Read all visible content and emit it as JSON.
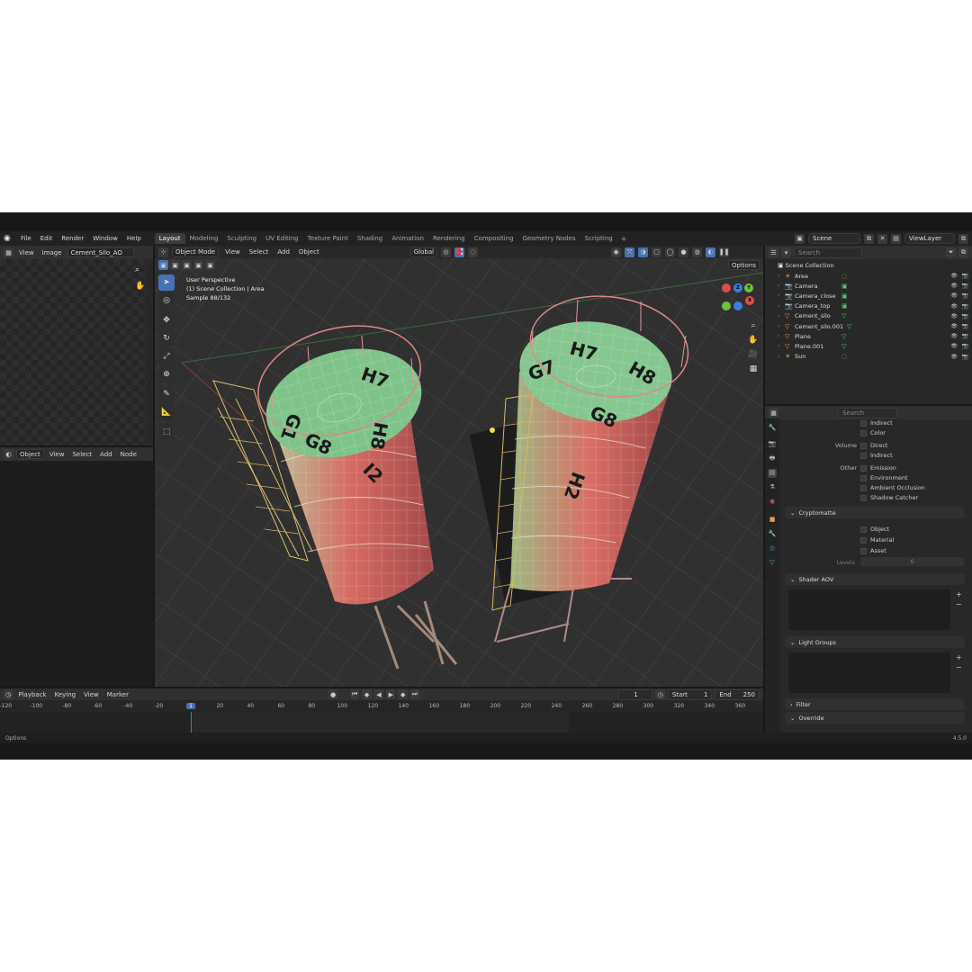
{
  "menu": [
    "File",
    "Edit",
    "Render",
    "Window",
    "Help"
  ],
  "workspaces": [
    "Layout",
    "Modeling",
    "Sculpting",
    "UV Editing",
    "Texture Paint",
    "Shading",
    "Animation",
    "Rendering",
    "Compositing",
    "Geometry Nodes",
    "Scripting"
  ],
  "active_workspace": "Layout",
  "scene_name": "Scene",
  "view_layer": "ViewLayer",
  "image_editor": {
    "menu": [
      "View",
      "Image"
    ],
    "image_name": "Cement_Silo_AO"
  },
  "node_editor": {
    "mode": "Object",
    "menu": [
      "View",
      "Select",
      "Add",
      "Node"
    ]
  },
  "viewport": {
    "mode": "Object Mode",
    "menu": [
      "View",
      "Select",
      "Add",
      "Object"
    ],
    "transform": "Global",
    "options": "Options",
    "info_line1": "User Perspective",
    "info_line2": "(1) Scene Collection | Area",
    "info_line3": "Sample 88/132",
    "silo_labels_left": [
      "H7",
      "G1",
      "H8",
      "G8",
      "I2"
    ],
    "silo_labels_right": [
      "H7",
      "G7",
      "H8",
      "G8",
      "H2"
    ]
  },
  "outliner": {
    "search_placeholder": "Search",
    "root": "Scene Collection",
    "items": [
      {
        "name": "Area",
        "icon": "light-icon"
      },
      {
        "name": "Camera",
        "icon": "camera-icon"
      },
      {
        "name": "Camera_close",
        "icon": "camera-icon"
      },
      {
        "name": "Camera_top",
        "icon": "camera-icon"
      },
      {
        "name": "Cement_silo",
        "icon": "mesh-icon"
      },
      {
        "name": "Cement_silo.001",
        "icon": "mesh-icon"
      },
      {
        "name": "Plane",
        "icon": "mesh-icon"
      },
      {
        "name": "Plane.001",
        "icon": "mesh-icon"
      },
      {
        "name": "Sun",
        "icon": "light-icon"
      }
    ]
  },
  "properties": {
    "search_placeholder": "Search",
    "light_rows": {
      "indirect": "Indirect",
      "color": "Color"
    },
    "volume_label": "Volume",
    "volume_rows": {
      "direct": "Direct",
      "indirect": "Indirect"
    },
    "other_label": "Other",
    "other_rows": {
      "emission": "Emission",
      "environment": "Environment",
      "ao": "Ambient Occlusion",
      "shadow": "Shadow Catcher"
    },
    "cryptomatte": "Cryptomatte",
    "crypto_rows": {
      "object": "Object",
      "material": "Material",
      "asset": "Asset"
    },
    "levels_label": "Levels",
    "levels_value": "6",
    "shader_aov": "Shader AOV",
    "light_groups": "Light Groups",
    "filter": "Filter",
    "override": "Override"
  },
  "timeline": {
    "menu": [
      "Playback",
      "Keying",
      "View",
      "Marker"
    ],
    "current_frame": "1",
    "start_label": "Start",
    "start": "1",
    "end_label": "End",
    "end": "250",
    "ruler": [
      "-120",
      "-100",
      "-80",
      "-60",
      "-40",
      "-20",
      "1",
      "20",
      "40",
      "60",
      "80",
      "100",
      "120",
      "140",
      "160",
      "180",
      "200",
      "220",
      "240",
      "260",
      "280",
      "300",
      "320",
      "340",
      "360"
    ]
  },
  "status": {
    "left": "Options",
    "version": "4.5.0"
  },
  "colors": {
    "accent": "#4772b3",
    "bg": "#181818",
    "panel": "#282828"
  }
}
